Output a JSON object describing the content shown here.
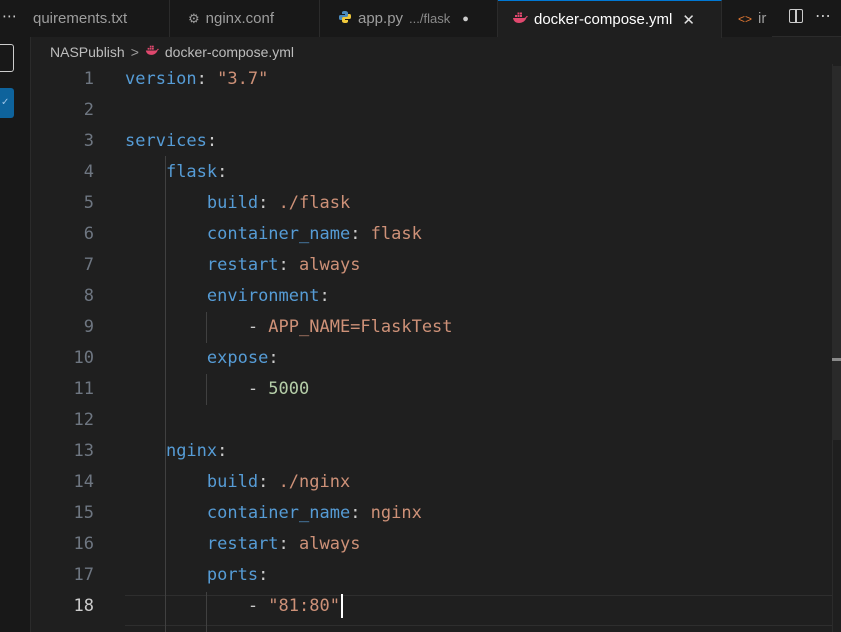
{
  "activity": {
    "more_glyph": "⋯"
  },
  "tabs": [
    {
      "label": "quirements.txt",
      "active": false
    },
    {
      "label": "nginx.conf",
      "icon": "gear-icon",
      "active": false
    },
    {
      "label": "app.py",
      "description": ".../flask",
      "icon": "python-icon",
      "dirty": true,
      "active": false
    },
    {
      "label": "docker-compose.yml",
      "icon": "docker-icon",
      "active": true,
      "close_glyph": "✕"
    },
    {
      "label": "ir",
      "icon": "code-brackets-icon",
      "active": false
    }
  ],
  "tab_actions": {
    "more_glyph": "⋯"
  },
  "breadcrumb": {
    "folder": "NASPublish",
    "separator": ">",
    "file": "docker-compose.yml"
  },
  "editor": {
    "current_line": 18,
    "lines": [
      {
        "num": "1",
        "tokens": [
          [
            "k",
            "version"
          ],
          [
            "p",
            ": "
          ],
          [
            "s",
            "\"3.7\""
          ]
        ]
      },
      {
        "num": "2",
        "tokens": []
      },
      {
        "num": "3",
        "tokens": [
          [
            "k",
            "services"
          ],
          [
            "p",
            ":"
          ]
        ]
      },
      {
        "num": "4",
        "tokens": [
          [
            "p",
            "    "
          ],
          [
            "k",
            "flask"
          ],
          [
            "p",
            ":"
          ]
        ]
      },
      {
        "num": "5",
        "tokens": [
          [
            "p",
            "        "
          ],
          [
            "k",
            "build"
          ],
          [
            "p",
            ": "
          ],
          [
            "s",
            "./flask"
          ]
        ]
      },
      {
        "num": "6",
        "tokens": [
          [
            "p",
            "        "
          ],
          [
            "k",
            "container_name"
          ],
          [
            "p",
            ": "
          ],
          [
            "s",
            "flask"
          ]
        ]
      },
      {
        "num": "7",
        "tokens": [
          [
            "p",
            "        "
          ],
          [
            "k",
            "restart"
          ],
          [
            "p",
            ": "
          ],
          [
            "s",
            "always"
          ]
        ]
      },
      {
        "num": "8",
        "tokens": [
          [
            "p",
            "        "
          ],
          [
            "k",
            "environment"
          ],
          [
            "p",
            ":"
          ]
        ]
      },
      {
        "num": "9",
        "tokens": [
          [
            "p",
            "            - "
          ],
          [
            "s",
            "APP_NAME=FlaskTest"
          ]
        ]
      },
      {
        "num": "10",
        "tokens": [
          [
            "p",
            "        "
          ],
          [
            "k",
            "expose"
          ],
          [
            "p",
            ":"
          ]
        ]
      },
      {
        "num": "11",
        "tokens": [
          [
            "p",
            "            - "
          ],
          [
            "n",
            "5000"
          ]
        ]
      },
      {
        "num": "12",
        "tokens": []
      },
      {
        "num": "13",
        "tokens": [
          [
            "p",
            "    "
          ],
          [
            "k",
            "nginx"
          ],
          [
            "p",
            ":"
          ]
        ]
      },
      {
        "num": "14",
        "tokens": [
          [
            "p",
            "        "
          ],
          [
            "k",
            "build"
          ],
          [
            "p",
            ": "
          ],
          [
            "s",
            "./nginx"
          ]
        ]
      },
      {
        "num": "15",
        "tokens": [
          [
            "p",
            "        "
          ],
          [
            "k",
            "container_name"
          ],
          [
            "p",
            ": "
          ],
          [
            "s",
            "nginx"
          ]
        ]
      },
      {
        "num": "16",
        "tokens": [
          [
            "p",
            "        "
          ],
          [
            "k",
            "restart"
          ],
          [
            "p",
            ": "
          ],
          [
            "s",
            "always"
          ]
        ]
      },
      {
        "num": "17",
        "tokens": [
          [
            "p",
            "        "
          ],
          [
            "k",
            "ports"
          ],
          [
            "p",
            ":"
          ]
        ]
      },
      {
        "num": "18",
        "tokens": [
          [
            "p",
            "            - "
          ],
          [
            "s",
            "\"81:80\""
          ]
        ]
      }
    ]
  },
  "colors": {
    "keyword": "#569cd6",
    "string": "#ce9178",
    "number": "#b5cea8",
    "accent": "#0078d4"
  }
}
